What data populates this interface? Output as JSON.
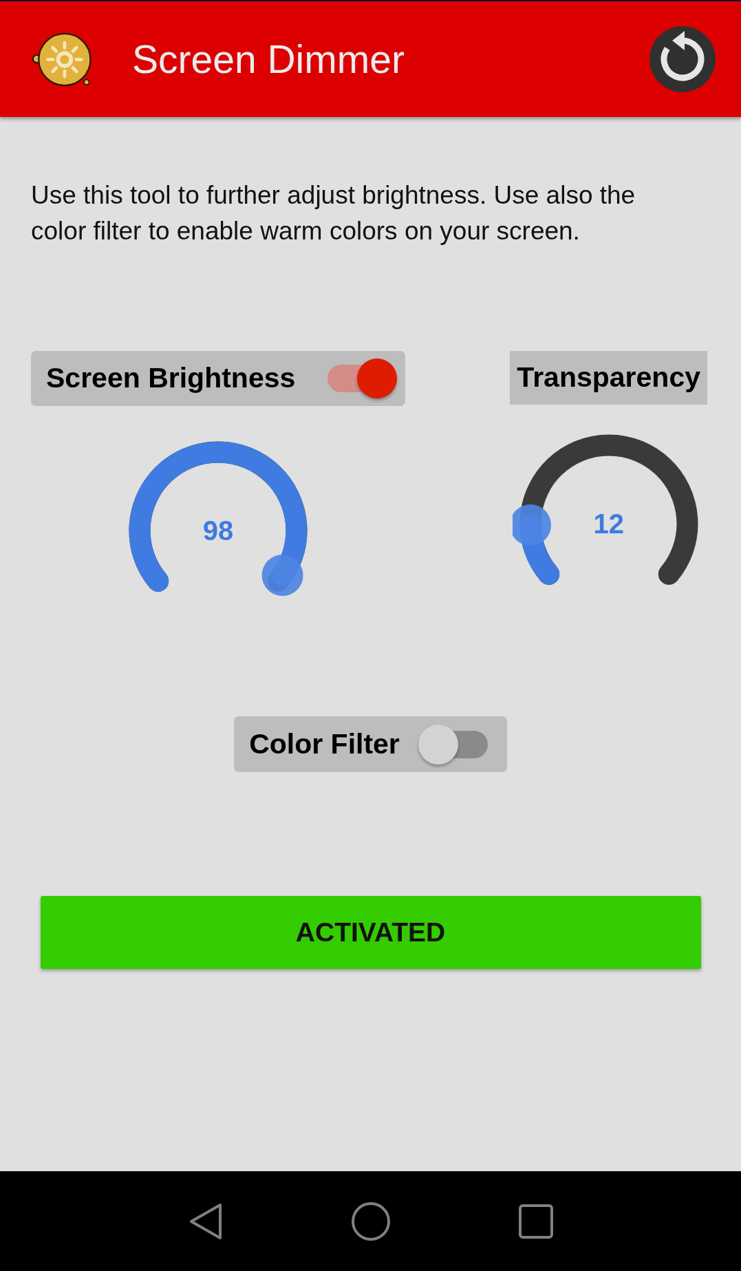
{
  "app_bar": {
    "title": "Screen Dimmer"
  },
  "description": "Use this tool to further adjust brightness. Use also the color filter to enable warm colors on your screen.",
  "controls": [
    {
      "kind": "switch",
      "label": "Screen Brightness",
      "on": true,
      "value": "98",
      "level": 0.98
    },
    {
      "kind": "plain",
      "label": "Transparency",
      "value": "12",
      "level": 0.15
    }
  ],
  "color_filter": {
    "label": "Color Filter",
    "on": false
  },
  "activate_button": {
    "label": "ACTIVATED"
  }
}
